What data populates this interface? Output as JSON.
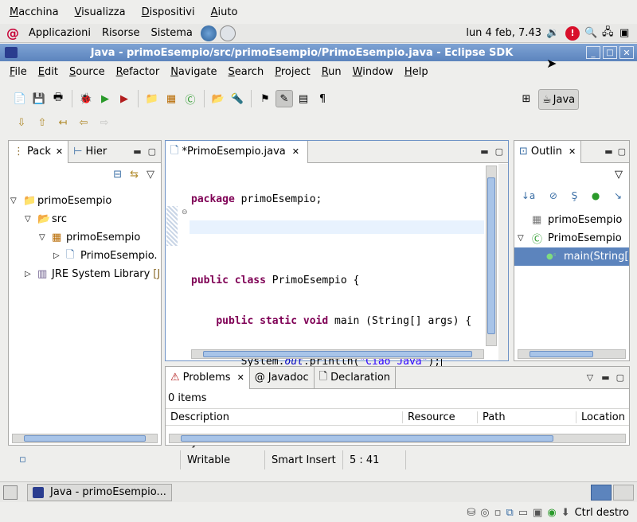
{
  "vbox_menu": [
    "Macchina",
    "Visualizza",
    "Dispositivi",
    "Aiuto"
  ],
  "gnome": {
    "apps": "Applicazioni",
    "places": "Risorse",
    "system": "Sistema",
    "clock": "lun  4 feb,  7.43"
  },
  "window": {
    "title": "Java - primoEsempio/src/primoEsempio/PrimoEsempio.java - Eclipse SDK"
  },
  "menu": [
    "File",
    "Edit",
    "Source",
    "Refactor",
    "Navigate",
    "Search",
    "Project",
    "Run",
    "Window",
    "Help"
  ],
  "perspective": {
    "label": "Java"
  },
  "package_explorer": {
    "tab1": "Pack",
    "tab2": "Hier",
    "tree": {
      "project": "primoEsempio",
      "src": "src",
      "package": "primoEsempio",
      "file": "PrimoEsempio.",
      "jre": "JRE System Library",
      "jre_suffix": "[J"
    }
  },
  "editor": {
    "tab": "*PrimoEsempio.java",
    "lines": {
      "l1a": "package",
      "l1b": " primoEsempio;",
      "l3a": "public",
      "l3b": "class",
      "l3c": " PrimoEsempio {",
      "l4a": "public",
      "l4b": "static",
      "l4c": "void",
      "l4d": " main (String[] args) {",
      "l5a": "System.",
      "l5b": "out",
      "l5c": ".println(",
      "l5d": "\"Ciao Java\"",
      "l5e": ");",
      "l6": "}",
      "l7": "}"
    }
  },
  "outline": {
    "tab": "Outlin",
    "items": [
      "primoEsempio",
      "PrimoEsempio",
      "main(String["
    ]
  },
  "problems": {
    "tab1": "Problems",
    "tab2": "Javadoc",
    "tab3": "Declaration",
    "count": "0 items",
    "columns": [
      "Description",
      "Resource",
      "Path",
      "Location"
    ]
  },
  "status": {
    "writable": "Writable",
    "insert": "Smart Insert",
    "position": "5 : 41"
  },
  "taskbar": {
    "item": "Java - primoEsempio..."
  },
  "vbox_status": {
    "host_key": "Ctrl destro"
  }
}
